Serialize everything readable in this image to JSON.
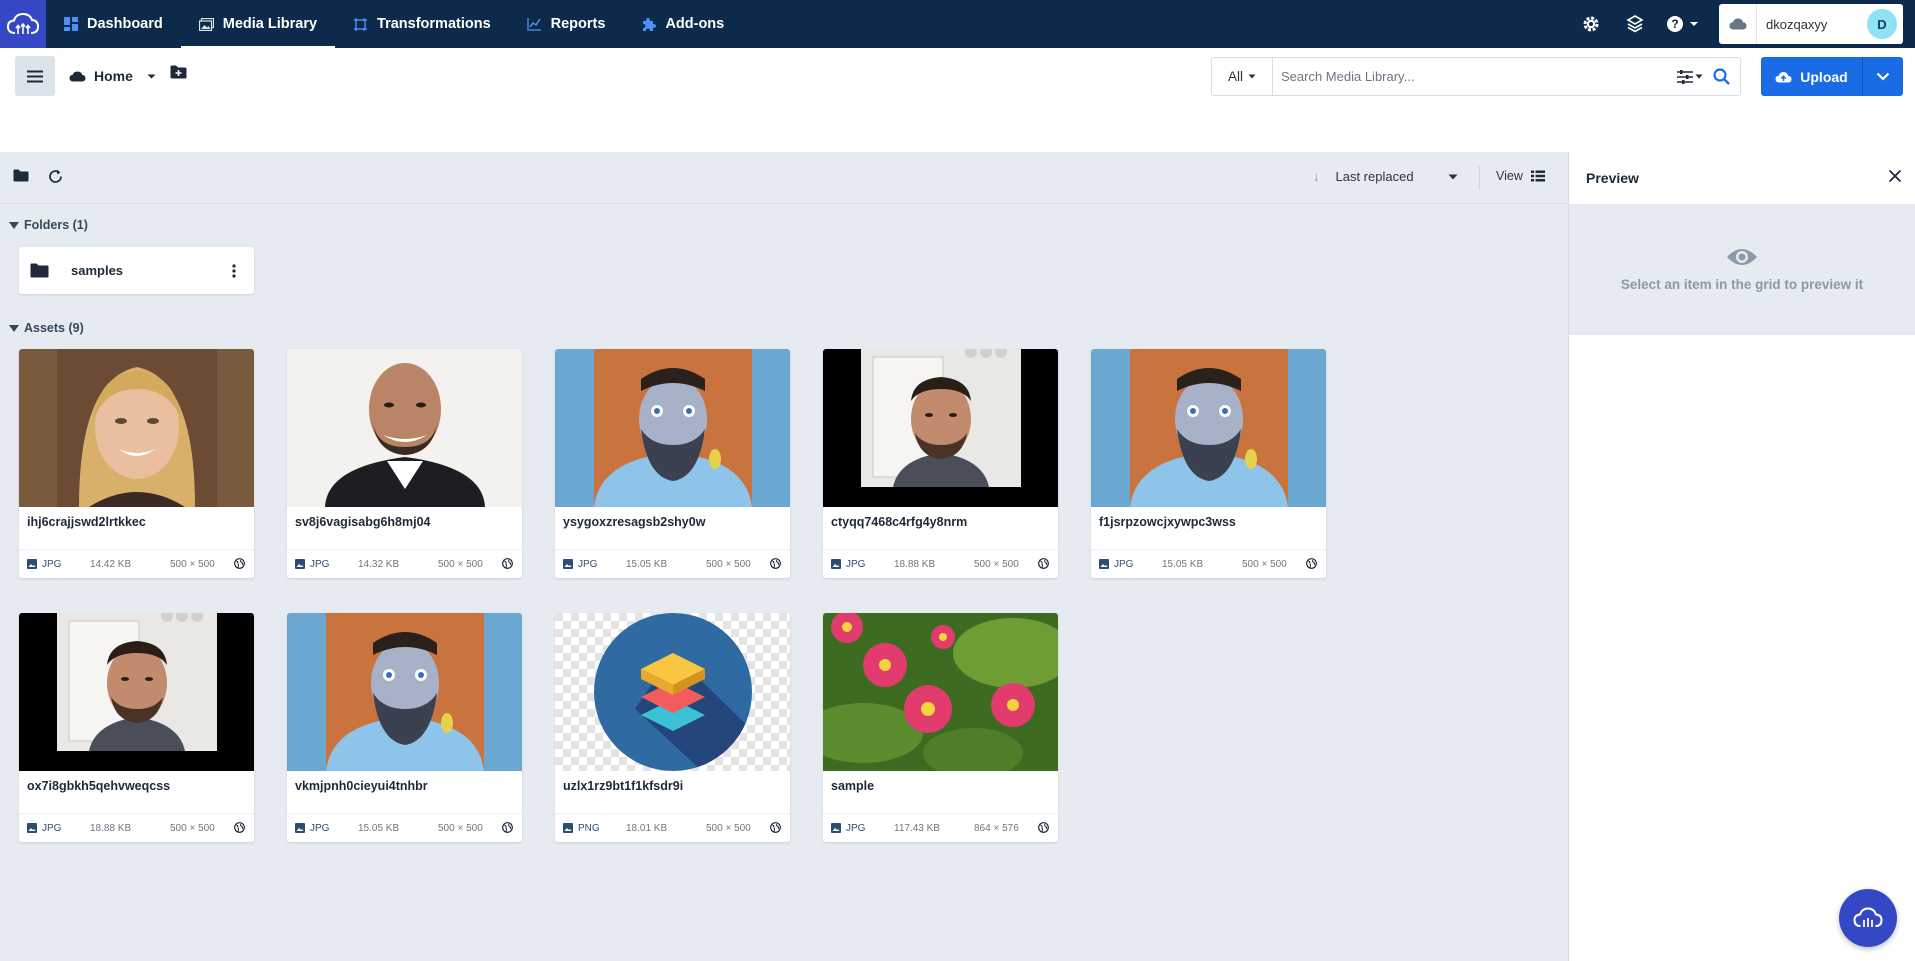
{
  "topnav": {
    "items": [
      {
        "label": "Dashboard",
        "icon": "dashboard-icon"
      },
      {
        "label": "Media Library",
        "icon": "media-library-icon",
        "active": true
      },
      {
        "label": "Transformations",
        "icon": "transformations-icon"
      },
      {
        "label": "Reports",
        "icon": "reports-icon"
      },
      {
        "label": "Add-ons",
        "icon": "puzzle-icon"
      }
    ],
    "account": {
      "name": "dkozqaxyy",
      "avatar_initial": "D"
    }
  },
  "toolbar": {
    "home_label": "Home",
    "search": {
      "scope": "All",
      "placeholder": "Search Media Library..."
    },
    "upload_label": "Upload"
  },
  "subbar": {
    "sort_label": "Last replaced",
    "view_label": "View"
  },
  "folders": {
    "title": "Folders (1)",
    "items": [
      {
        "name": "samples"
      }
    ]
  },
  "assets": {
    "title": "Assets (9)",
    "items": [
      {
        "name": "ihj6crajjswd2lrtkkec",
        "format": "JPG",
        "size": "14.42 KB",
        "dims": "500 × 500"
      },
      {
        "name": "sv8j6vagisabg6h8mj04",
        "format": "JPG",
        "size": "14.32 KB",
        "dims": "500 × 500"
      },
      {
        "name": "ysygoxzresagsb2shy0w",
        "format": "JPG",
        "size": "15.05 KB",
        "dims": "500 × 500"
      },
      {
        "name": "ctyqq7468c4rfg4y8nrm",
        "format": "JPG",
        "size": "18.88 KB",
        "dims": "500 × 500"
      },
      {
        "name": "f1jsrpzowcjxywpc3wss",
        "format": "JPG",
        "size": "15.05 KB",
        "dims": "500 × 500"
      },
      {
        "name": "ox7i8gbkh5qehvweqcss",
        "format": "JPG",
        "size": "18.88 KB",
        "dims": "500 × 500"
      },
      {
        "name": "vkmjpnh0cieyui4tnhbr",
        "format": "JPG",
        "size": "15.05 KB",
        "dims": "500 × 500"
      },
      {
        "name": "uzlx1rz9bt1f1kfsdr9i",
        "format": "PNG",
        "size": "18.01 KB",
        "dims": "500 × 500"
      },
      {
        "name": "sample",
        "format": "JPG",
        "size": "117.43 KB",
        "dims": "864 × 576"
      }
    ]
  },
  "preview": {
    "title": "Preview",
    "empty_message": "Select an item in the grid to preview it"
  },
  "colors": {
    "nav_bg": "#0c2b4b",
    "brand": "#3448c5",
    "accent": "#1a6ce6",
    "content_bg": "#e5ebf1"
  }
}
